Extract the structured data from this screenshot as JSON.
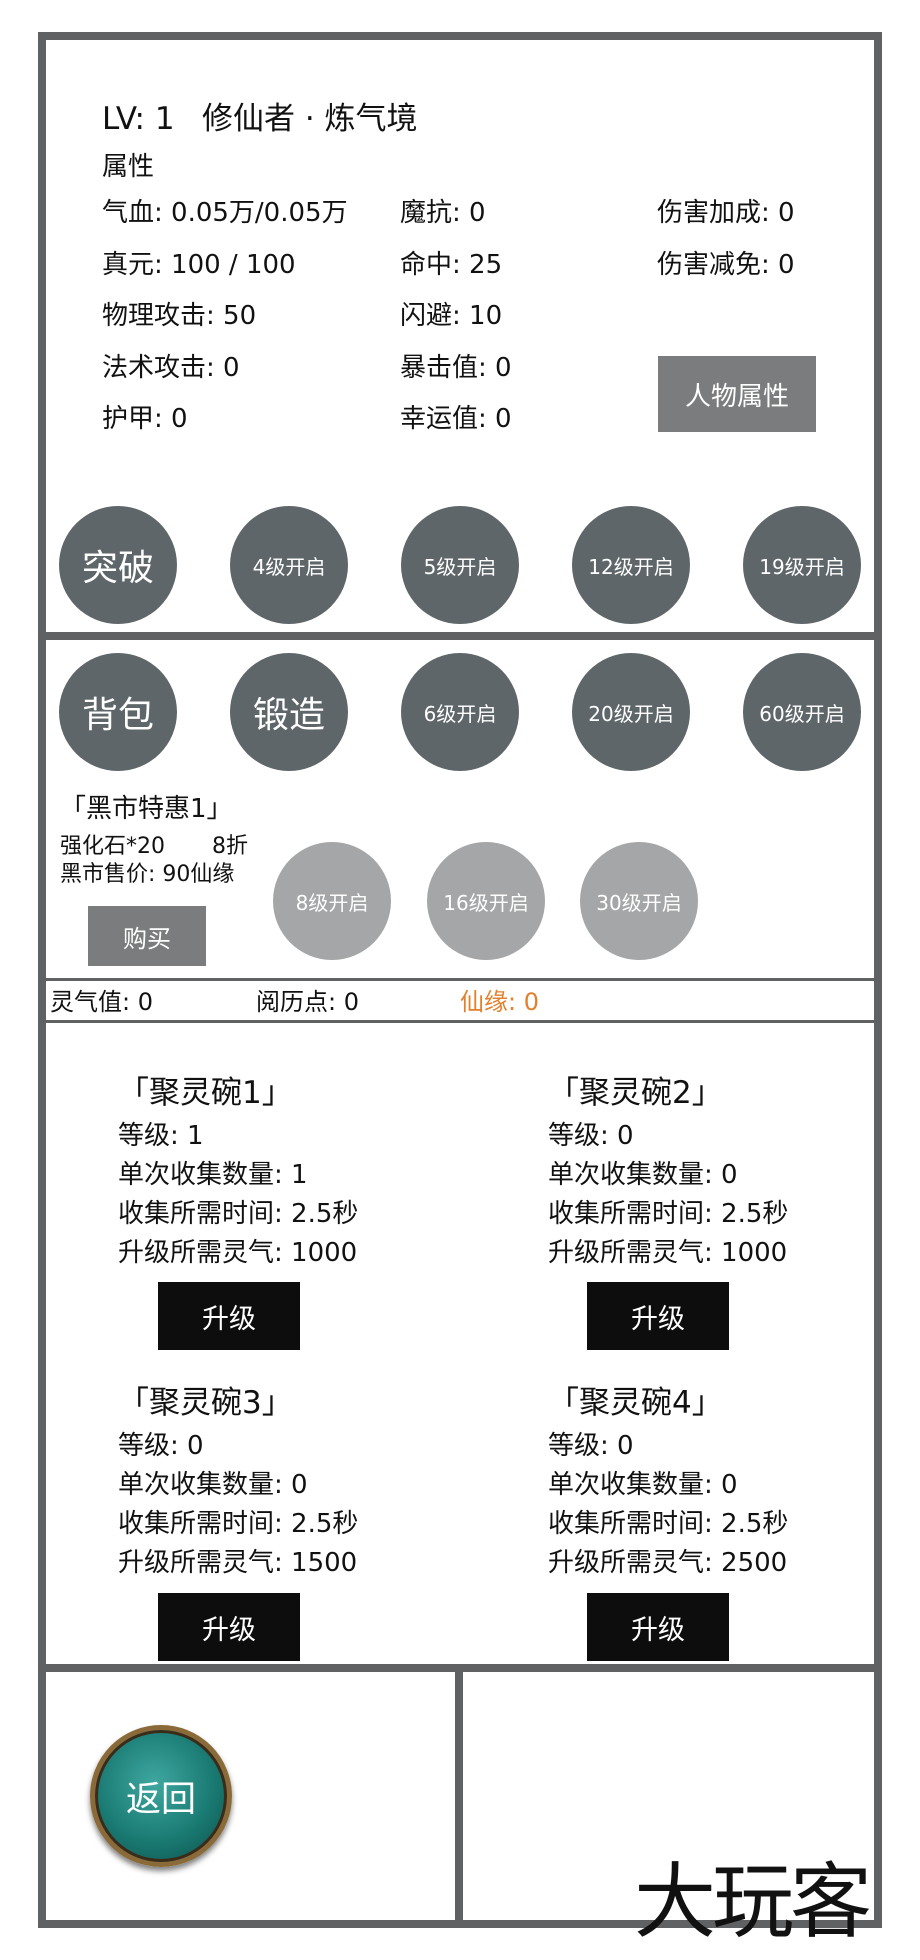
{
  "header": {
    "level": "LV: 1",
    "rank": "修仙者 · 炼气境",
    "section": "属性"
  },
  "stats": {
    "col1": [
      "气血: 0.05万/0.05万",
      "真元: 100 / 100",
      "物理攻击: 50",
      "法术攻击: 0",
      "护甲: 0"
    ],
    "col2": [
      "魔抗: 0",
      "命中: 25",
      "闪避: 10",
      "暴击值: 0",
      "幸运值: 0"
    ],
    "col3": [
      "伤害加成: 0",
      "伤害减免: 0"
    ],
    "char_button": "人物属性"
  },
  "row1": [
    "突破",
    "4级开启",
    "5级开启",
    "12级开启",
    "19级开启"
  ],
  "row2": [
    "背包",
    "锻造",
    "6级开启",
    "20级开启",
    "60级开启"
  ],
  "row3": [
    "8级开启",
    "16级开启",
    "30级开启"
  ],
  "market": {
    "title": "「黑市特惠1」",
    "item": "强化石*20",
    "discount": "8折",
    "price": "黑市售价: 90仙缘",
    "buy": "购买"
  },
  "currency": {
    "spirit": "灵气值: 0",
    "experience": "阅历点: 0",
    "fate": "仙缘: 0"
  },
  "bowls": [
    {
      "title": "「聚灵碗1」",
      "level": "等级: 1",
      "amount": "单次收集数量: 1",
      "time": "收集所需时间: 2.5秒",
      "cost": "升级所需灵气: 1000",
      "upgrade": "升级"
    },
    {
      "title": "「聚灵碗2」",
      "level": "等级: 0",
      "amount": "单次收集数量: 0",
      "time": "收集所需时间: 2.5秒",
      "cost": "升级所需灵气: 1000",
      "upgrade": "升级"
    },
    {
      "title": "「聚灵碗3」",
      "level": "等级: 0",
      "amount": "单次收集数量: 0",
      "time": "收集所需时间: 2.5秒",
      "cost": "升级所需灵气: 1500",
      "upgrade": "升级"
    },
    {
      "title": "「聚灵碗4」",
      "level": "等级: 0",
      "amount": "单次收集数量: 0",
      "time": "收集所需时间: 2.5秒",
      "cost": "升级所需灵气: 2500",
      "upgrade": "升级"
    }
  ],
  "footer": {
    "back": "返回",
    "watermark": "大玩客"
  },
  "colors": {
    "frame": "#5f6163",
    "circle": "#5f6669",
    "circle_locked": "#a4a6a7",
    "accent": "#e2802c"
  }
}
